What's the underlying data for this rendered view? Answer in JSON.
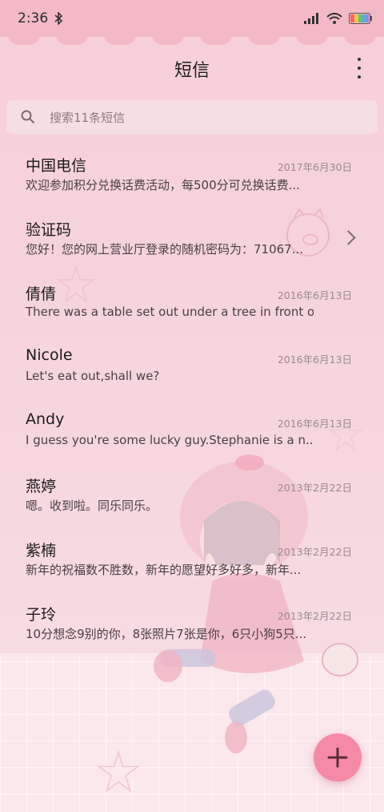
{
  "status_bar": {
    "time": "2:36"
  },
  "app_bar": {
    "title": "短信"
  },
  "search": {
    "placeholder": "搜索11条短信"
  },
  "conversations": [
    {
      "name": "中国电信",
      "date": "2017年6月30日",
      "preview": "欢迎参加积分兑换话费活动，每500分可兑换话费..."
    },
    {
      "name": "验证码",
      "date": "",
      "preview": "您好！您的网上营业厅登录的随机密码为：71067..."
    },
    {
      "name": "倩倩",
      "date": "2016年6月13日",
      "preview": "There was a table set out under a tree in front o..."
    },
    {
      "name": "Nicole",
      "date": "2016年6月13日",
      "preview": "Let's eat out,shall we?"
    },
    {
      "name": "Andy",
      "date": "2016年6月13日",
      "preview": "I guess you're some lucky guy.Stephanie is a n..."
    },
    {
      "name": "燕婷",
      "date": "2013年2月22日",
      "preview": "嗯。收到啦。同乐同乐。"
    },
    {
      "name": "紫楠",
      "date": "2013年2月22日",
      "preview": "新年的祝福数不胜数，新年的愿望好多好多，新年..."
    },
    {
      "name": "子玲",
      "date": "2013年2月22日",
      "preview": "10分想念9别的你，8张照片7张是你，6只小狗5只..."
    }
  ],
  "icons": {
    "bluetooth": "bluetooth-icon",
    "signal": "signal-icon",
    "wifi": "wifi-icon",
    "battery": "battery-icon",
    "more": "more-icon",
    "search": "search-icon",
    "chevron": "chevron-right-icon",
    "compose": "compose-icon"
  },
  "colors": {
    "accent": "#f48aa6",
    "background": "#fbe8ec"
  }
}
